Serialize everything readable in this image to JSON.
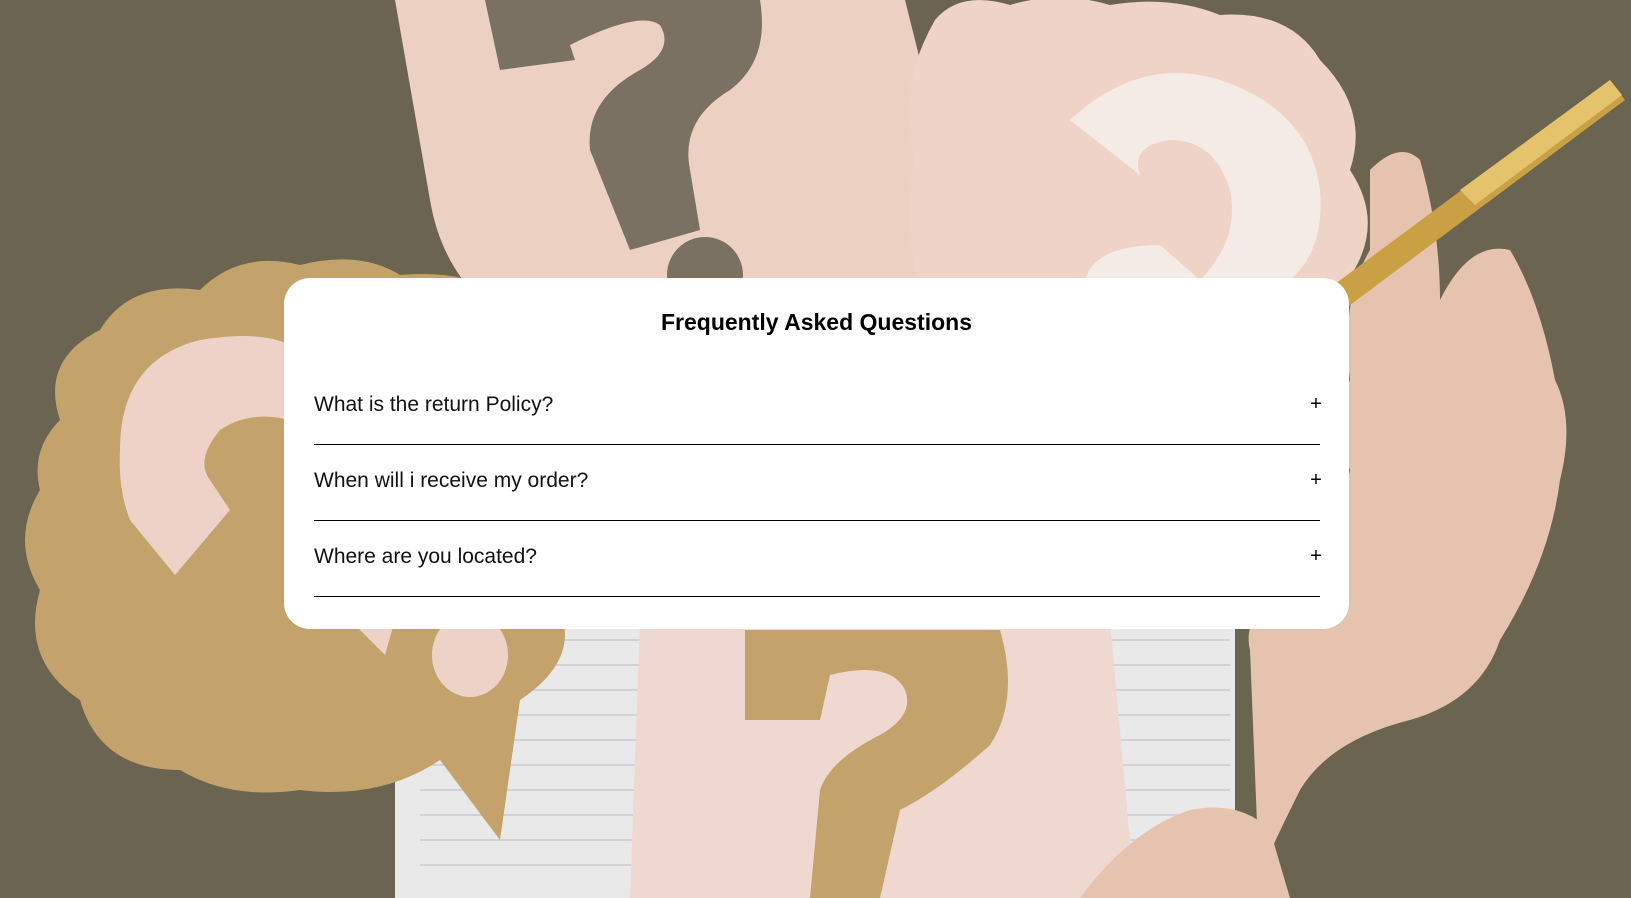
{
  "faq": {
    "title": "Frequently Asked Questions",
    "toggle_symbol": "+",
    "items": [
      {
        "question": "What is the return Policy?"
      },
      {
        "question": "When will i receive my order?"
      },
      {
        "question": "Where are you located?"
      }
    ]
  },
  "background": {
    "description_icon": "question-mark-paper-cutouts-photo",
    "colors": {
      "table": "#6b6450",
      "pink_paper": "#ecd2c4",
      "kraft_paper": "#c2a26a",
      "dark_cutout": "#7a7060",
      "light_cutout": "#f4eae6",
      "skin": "#e8c2ad",
      "notebook": "#ececec",
      "pen_gold": "#c9a040"
    }
  }
}
